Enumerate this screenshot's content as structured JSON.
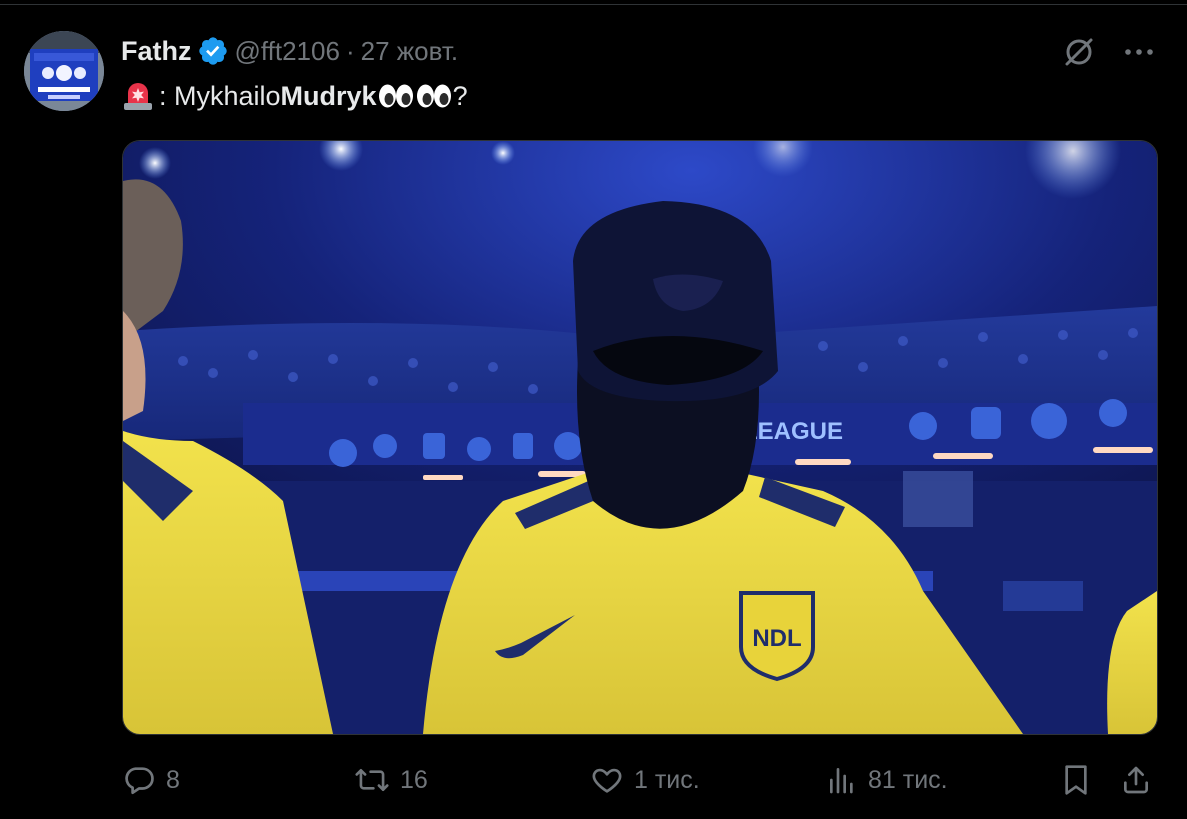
{
  "post": {
    "author": {
      "display_name": "Fathz",
      "handle": "@fft2106",
      "verified": true,
      "avatar_icon": "chelsea-world-champions-avatar"
    },
    "separator": "·",
    "date": "27 жовт.",
    "text": {
      "prefix": ": Mykhailo ",
      "bold": "Mudryk",
      "suffix": "?",
      "emoji": [
        "siren-emoji",
        "eyes-emoji",
        "eyes-emoji"
      ]
    },
    "media": {
      "type": "image",
      "board_text": "LEAGUE",
      "crest_text": "NDL"
    },
    "stats": {
      "replies": "8",
      "reposts": "16",
      "likes": "1 тис.",
      "views": "81 тис."
    }
  },
  "colors": {
    "background": "#000000",
    "text": "#e7e9ea",
    "muted": "#71767b",
    "verified": "#1d9bf0",
    "border": "#2f3336",
    "kit_yellow": "#e3d23e",
    "kit_navy": "#1f2d6b"
  }
}
